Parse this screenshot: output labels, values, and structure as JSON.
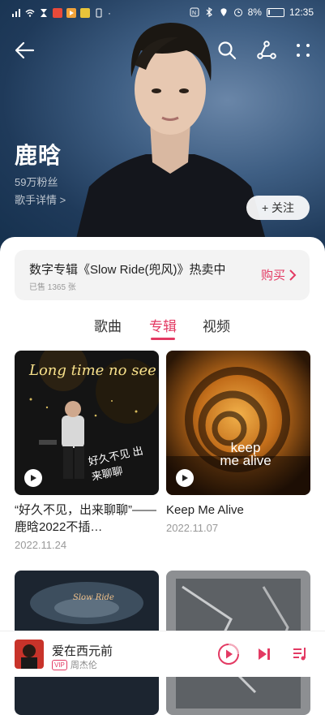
{
  "status_bar": {
    "battery": "8%",
    "time": "12:35"
  },
  "artist": {
    "name": "鹿晗",
    "fans": "59万粉丝",
    "detail_link": "歌手详情 >"
  },
  "follow_label": "+ 关注",
  "promo": {
    "title": "数字专辑《Slow Ride(兜风)》热卖中",
    "sold": "已售 1365 张",
    "buy_label": "购买"
  },
  "tabs": [
    {
      "label": "歌曲"
    },
    {
      "label": "专辑"
    },
    {
      "label": "视频"
    }
  ],
  "active_tab": "专辑",
  "albums": [
    {
      "title": "“好久不见，出来聊聊”——鹿晗2022不插…",
      "date": "2022.11.24",
      "cover_text": "Long time no see",
      "cover_text2": "好久不见 出来聊聊"
    },
    {
      "title": "Keep Me Alive",
      "date": "2022.11.07",
      "cover_text": "keep me alive"
    },
    {
      "cover_text": "Slow Ride"
    },
    {}
  ],
  "now_playing": {
    "title": "爱在西元前",
    "vip": "VIP",
    "artist": "周杰伦"
  },
  "colors": {
    "accent": "#e33a63",
    "hero_bg": "#2a4a70"
  }
}
